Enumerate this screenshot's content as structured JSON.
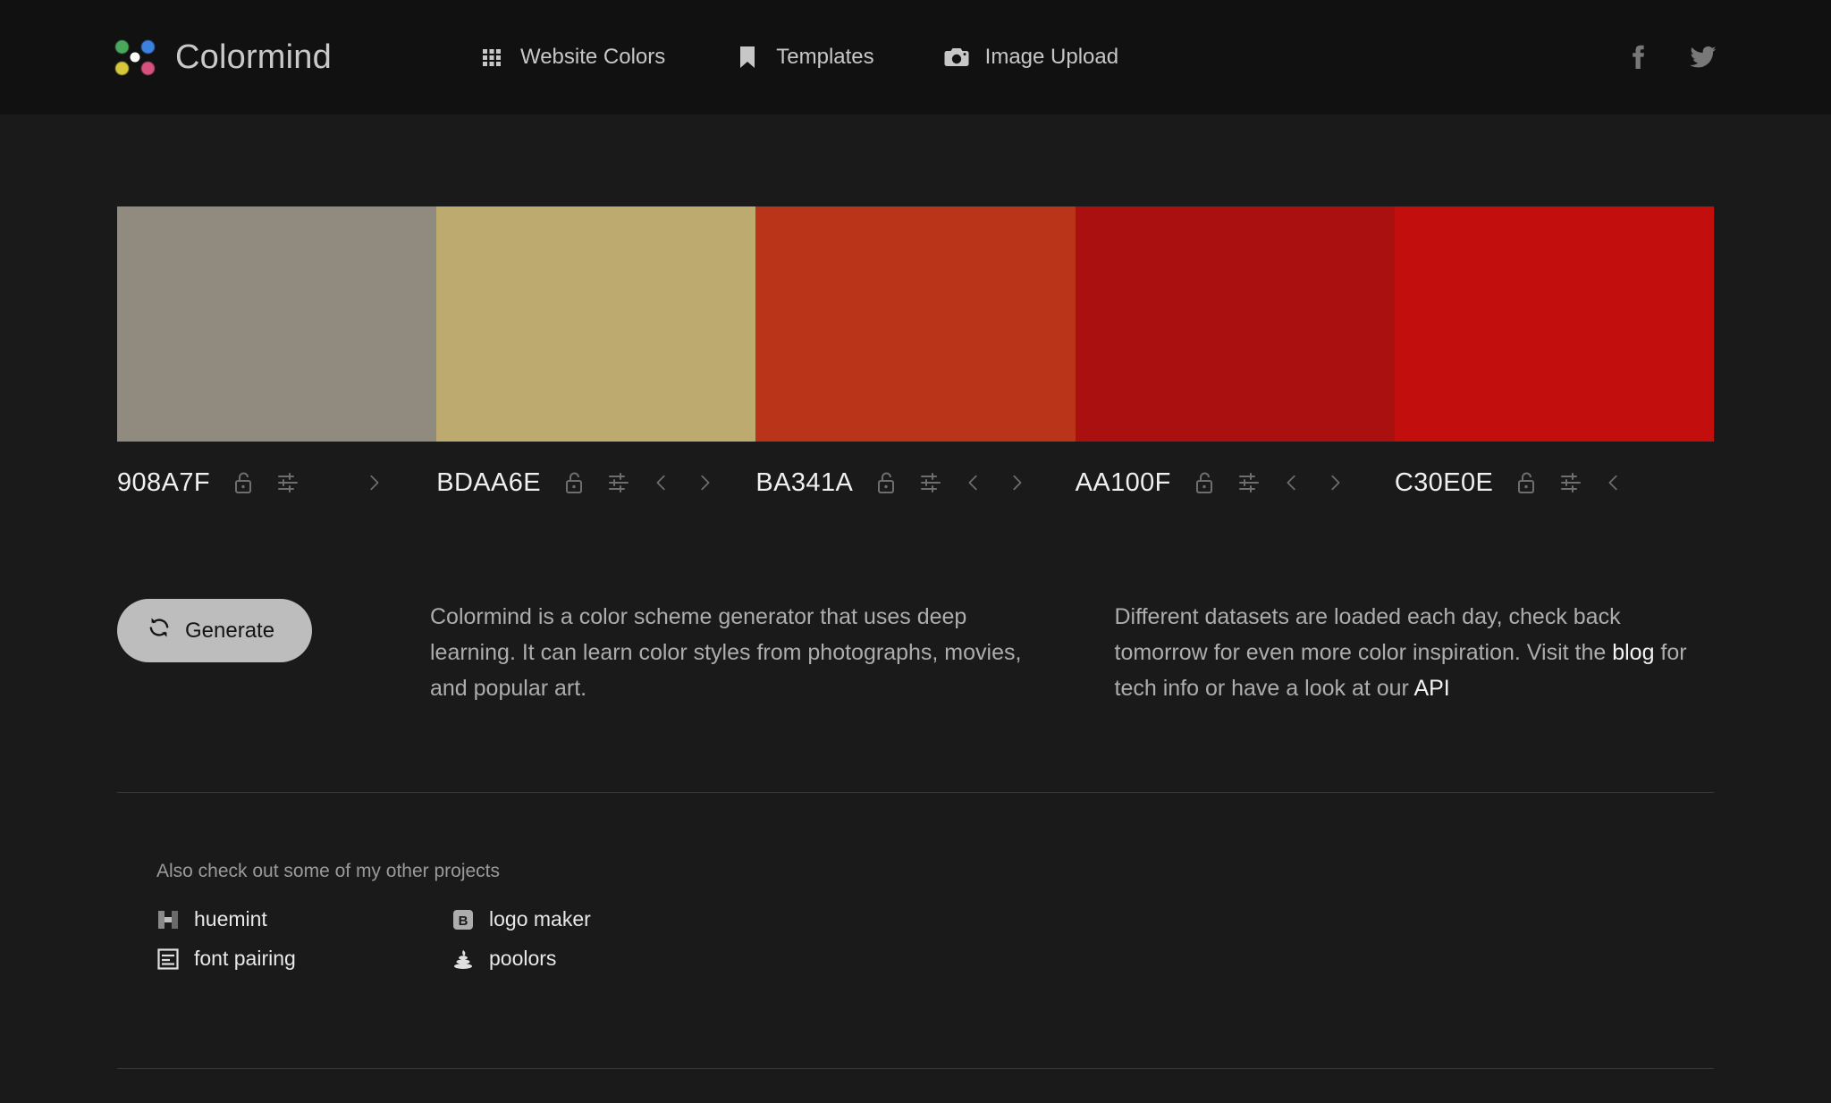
{
  "header": {
    "brand": "Colormind",
    "logo_colors": {
      "top_left": "#4aa85c",
      "top_right": "#3b82e0",
      "bottom_left": "#d7c73a",
      "bottom_right": "#d8507d",
      "center": "#ffffff"
    },
    "nav": [
      {
        "label": "Website Colors",
        "icon": "grid-icon"
      },
      {
        "label": "Templates",
        "icon": "bookmark-icon"
      },
      {
        "label": "Image Upload",
        "icon": "camera-icon"
      }
    ],
    "socials": [
      {
        "name": "facebook-icon"
      },
      {
        "name": "twitter-icon"
      }
    ]
  },
  "palette": {
    "swatches": [
      {
        "hex": "908A7F",
        "color": "#908A7F",
        "locked": false,
        "has_prev": false,
        "has_next": true
      },
      {
        "hex": "BDAA6E",
        "color": "#BDAA6E",
        "locked": false,
        "has_prev": true,
        "has_next": true
      },
      {
        "hex": "BA341A",
        "color": "#BA341A",
        "locked": false,
        "has_prev": true,
        "has_next": true
      },
      {
        "hex": "AA100F",
        "color": "#AA100F",
        "locked": false,
        "has_prev": true,
        "has_next": true
      },
      {
        "hex": "C30E0E",
        "color": "#C30E0E",
        "locked": false,
        "has_prev": true,
        "has_next": false
      }
    ],
    "lock_icon": "unlock-icon",
    "tune_icon": "sliders-icon",
    "prev_icon": "chevron-left-icon",
    "next_icon": "chevron-right-icon"
  },
  "actions": {
    "generate_label": "Generate",
    "generate_icon": "refresh-icon"
  },
  "info": {
    "left": "Colormind is a color scheme generator that uses deep learning. It can learn color styles from photographs, movies, and popular art.",
    "right_part1": "Different datasets are loaded each day, check back tomorrow for even more color inspiration. Visit the ",
    "right_link_blog": "blog",
    "right_part2": " for tech info or have a look at our ",
    "right_link_api": "API"
  },
  "footer": {
    "title": "Also check out some of my other projects",
    "projects": [
      {
        "label": "huemint",
        "icon": "huemint-icon"
      },
      {
        "label": "logo maker",
        "icon": "logomaker-icon"
      },
      {
        "label": "font pairing",
        "icon": "fontpairing-icon"
      },
      {
        "label": "poolors",
        "icon": "poolors-icon"
      }
    ]
  }
}
